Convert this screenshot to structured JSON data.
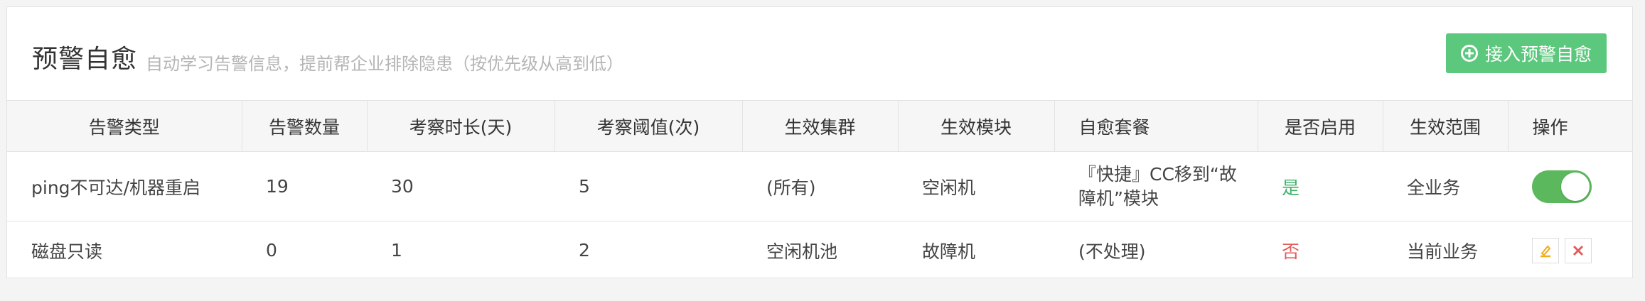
{
  "header": {
    "title": "预警自愈",
    "subtitle": "自动学习告警信息，提前帮企业排除隐患（按优先级从高到低）",
    "add_button_label": "接入预警自愈"
  },
  "table": {
    "columns": [
      "告警类型",
      "告警数量",
      "考察时长(天)",
      "考察阈值(次)",
      "生效集群",
      "生效模块",
      "自愈套餐",
      "是否启用",
      "生效范围",
      "操作"
    ],
    "rows": [
      {
        "alarm_type": "ping不可达/机器重启",
        "alarm_count": "19",
        "duration_days": "30",
        "threshold": "5",
        "cluster": "(所有)",
        "module": "空闲机",
        "package": "『快捷』CC移到“故障机”模块",
        "enabled": "是",
        "scope": "全业务",
        "action": "toggle-on"
      },
      {
        "alarm_type": "磁盘只读",
        "alarm_count": "0",
        "duration_days": "1",
        "threshold": "2",
        "cluster": "空闲机池",
        "module": "故障机",
        "package": "(不处理)",
        "enabled": "否",
        "scope": "当前业务",
        "action": "edit-delete"
      }
    ]
  },
  "colors": {
    "accent_green": "#5cc87d",
    "yes_green": "#3fb26a",
    "no_red": "#e35c5c",
    "edit_orange": "#f0ad1e",
    "delete_red": "#e35c5c"
  }
}
